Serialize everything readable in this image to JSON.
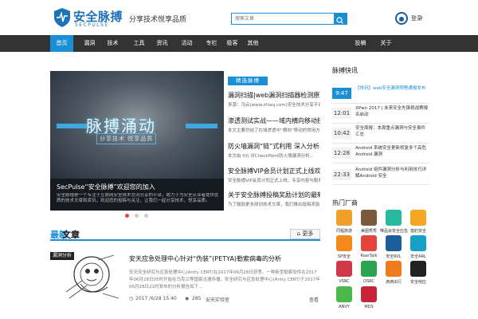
{
  "header": {
    "logo_cn": "安全脉搏",
    "logo_en": "SECPULSE",
    "tagline": "分享技术悦享品质",
    "search_placeholder": "搜索文章",
    "user_label": "登录"
  },
  "nav": {
    "items": [
      "首页",
      "漏洞",
      "技术",
      "工具",
      "资讯",
      "活动",
      "专栏",
      "极客",
      "其他"
    ],
    "right_items": [
      "投稿",
      "关于"
    ],
    "active_index": 0
  },
  "slider": {
    "art_title": "脉搏涌动",
    "art_subtitle": "分享技术 悦享品质",
    "caption_title": "SecPulse“安全脉搏”欢迎您的加入",
    "caption_desc": "安全脉搏是一个专注于互联网安全技术交流分享的平台，致力于为安全从业者提供优质的技术文章和资讯，欢迎您的投稿与关注，让我们一起分享技术，悦享品质。",
    "dots": 3,
    "active_dot": 0
  },
  "picks": {
    "heading": "精选脉搏",
    "items": [
      {
        "title": "漏洞扫描|web漏洞扫描器检测原理分析",
        "desc": "来源：乌云(www.zhiaq.com)安全技术分享平台..."
      },
      {
        "title": "渗透测试实战——域内横向移动技巧总结",
        "desc": "本文主要总结了在域渗透中“横向”移动的常用方法与技巧..."
      },
      {
        "title": "防火墙漏洞“链”式利用 深入分析与复现",
        "desc": "本文由 f(f) 对CheckPoint防火墙漏洞分析..."
      },
      {
        "title": "安全脉搏VIP会员计划正式上线欢迎加入",
        "desc": "安全脉搏VIP会员计划正式上线，专享内容与服务..."
      },
      {
        "title": "关于安全脉搏投稿奖励计划的最新公告说明",
        "desc": "为了鼓励更多原创技术文章，我们推出投稿奖励..."
      }
    ]
  },
  "news": {
    "heading": "脉搏快讯",
    "items": [
      {
        "time": "9:47",
        "text": "【快讯】web安全漏洞预警通报发布",
        "highlight": true
      },
      {
        "time": "12:01",
        "text": "XPwn 2017 | 未来安全先锋挑战赛报名启动",
        "highlight": false
      },
      {
        "time": "10:42",
        "text": "安全周报：本周重点漏洞与安全事件汇总",
        "highlight": false
      },
      {
        "time": "12:28",
        "text": "Android 系统安全更新修复多个高危Android 漏洞",
        "highlight": false
      },
      {
        "time": "22:33",
        "text": "Android 组件漏洞分析与利用技巧详解Android 安全",
        "highlight": false
      }
    ]
  },
  "hot": {
    "heading": "热门厂商",
    "items": [
      {
        "name": "同程旅游",
        "color": "#f0a02a"
      },
      {
        "name": "美图秀秀",
        "color": "#7a5a3c"
      },
      {
        "name": "唯品会安全应急",
        "color": "#29b8a0"
      },
      {
        "name": "猎豹安全",
        "color": "#f5a623"
      },
      {
        "name": "SP安全",
        "color": "#f28a1e"
      },
      {
        "name": "RoarTalk",
        "color": "#e4453a"
      },
      {
        "name": "安全RVL",
        "color": "#1b5e9b"
      },
      {
        "name": "安全ARL",
        "color": "#16a0c8"
      },
      {
        "name": "VSRC",
        "color": "#d0394b"
      },
      {
        "name": "DSRC",
        "color": "#2aa44f"
      },
      {
        "name": "滴滴出行",
        "color": "#f07a1e"
      },
      {
        "name": "安全响应",
        "color": "#222222"
      },
      {
        "name": "ANVY",
        "color": "#4bb84b"
      },
      {
        "name": "MDS",
        "color": "#c8253a"
      }
    ]
  },
  "section": {
    "heading_a": "最新",
    "heading_b": "文章",
    "more_label": "更多"
  },
  "article": {
    "tag": "漏洞分析",
    "title": "安天应急处理中心针对“伪装”(PETYA)勒索病毒的分析",
    "desc": "安天安全研究与应急处理中心(Antiy CERT)在2017年06月28日获悉，一种新型勒索软件在2017年06月28日05时开始在乌克兰等国家迅速传播，安全研究与应急处理中心(Antiy CERT)于2017年06月28日21时发布的分析报告如下...",
    "date": "2017 /6/28 15:40",
    "views": "285",
    "category": "安天实验室",
    "action": "查看"
  },
  "colors": {
    "accent": "#1b8fd6",
    "nav_bg": "#333333",
    "dot_active": "#e8452f"
  }
}
